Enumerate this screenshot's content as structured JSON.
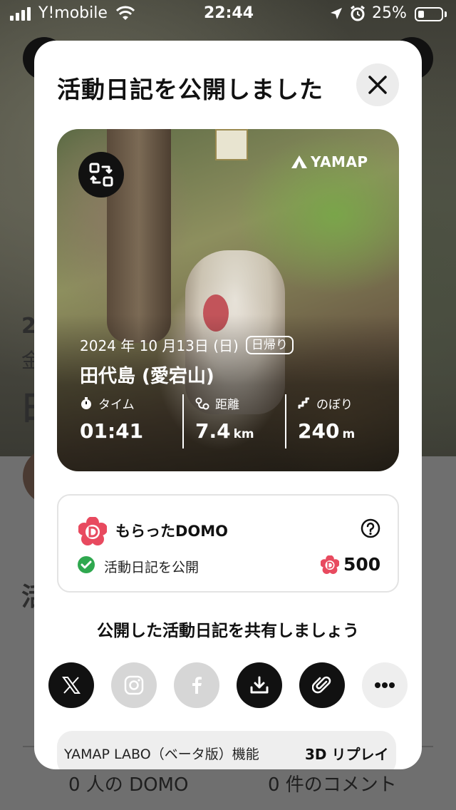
{
  "status_bar": {
    "carrier": "Y!mobile",
    "time": "22:44",
    "battery": "25%"
  },
  "background": {
    "glyph_2": "2",
    "glyph_kin": "金",
    "glyph_hi": "日",
    "glyph_katsu": "活",
    "domo_count": "0 人の DOMO",
    "comment_count": "0 件のコメント"
  },
  "modal": {
    "title": "活動日記を公開しました",
    "card": {
      "brand": "YAMAP",
      "date": "2024 年 10 月13日 (日)",
      "trip_type": "日帰り",
      "mountain": "田代島 (愛宕山)",
      "stats": [
        {
          "label": "タイム",
          "value": "01:41",
          "unit": ""
        },
        {
          "label": "距離",
          "value": "7.4",
          "unit": "km"
        },
        {
          "label": "のぼり",
          "value": "240",
          "unit": "m"
        }
      ]
    },
    "domo": {
      "title": "もらったDOMO",
      "action": "活動日記を公開",
      "points": "500"
    },
    "share_prompt": "公開した活動日記を共有しましょう",
    "share_icons": [
      "x-icon",
      "instagram-icon",
      "facebook-icon",
      "download-icon",
      "link-icon",
      "more-icon"
    ],
    "labo": {
      "text": "YAMAP LABO（ベータ版）機能",
      "replay": "3D リプレイ"
    }
  },
  "colors": {
    "accent_red": "#e84a5f",
    "check_green": "#2fa84f",
    "dark": "#111111"
  }
}
